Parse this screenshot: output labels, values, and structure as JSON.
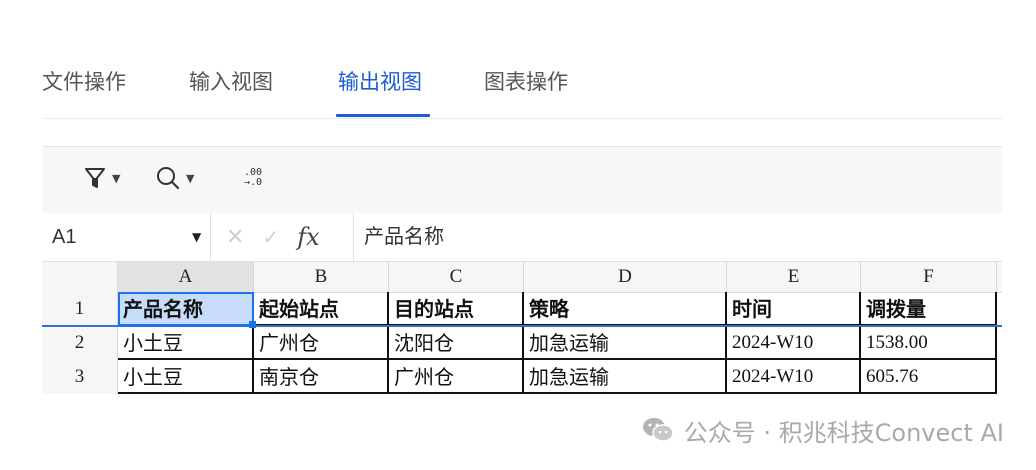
{
  "tabs": [
    {
      "label": "文件操作",
      "active": false
    },
    {
      "label": "输入视图",
      "active": false
    },
    {
      "label": "输出视图",
      "active": true
    },
    {
      "label": "图表操作",
      "active": false
    }
  ],
  "toolbar": {
    "filter_icon": "filter-icon",
    "search_icon": "search-icon",
    "decimal_icon": "decimal-places-icon",
    "decimal_top": ".00",
    "decimal_bottom": "→.0"
  },
  "formula_bar": {
    "cell_ref": "A1",
    "fx_label": "fx",
    "value": "产品名称"
  },
  "sheet": {
    "column_headers": [
      "A",
      "B",
      "C",
      "D",
      "E",
      "F"
    ],
    "row_numbers": [
      "1",
      "2",
      "3"
    ],
    "rows": [
      [
        "产品名称",
        "起始站点",
        "目的站点",
        "策略",
        "时间",
        "调拨量"
      ],
      [
        "小土豆",
        "广州仓",
        "沈阳仓",
        "加急运输",
        "2024-W10",
        "1538.00"
      ],
      [
        "小土豆",
        "南京仓",
        "广州仓",
        "加急运输",
        "2024-W10",
        "605.76"
      ]
    ],
    "selected_cell": "A1"
  },
  "colors": {
    "accent": "#1e5bd6",
    "selection_fill": "#c6dcf8",
    "selection_border": "#1a73e8"
  },
  "watermark": {
    "text": "公众号 · 积兆科技Convect AI"
  }
}
